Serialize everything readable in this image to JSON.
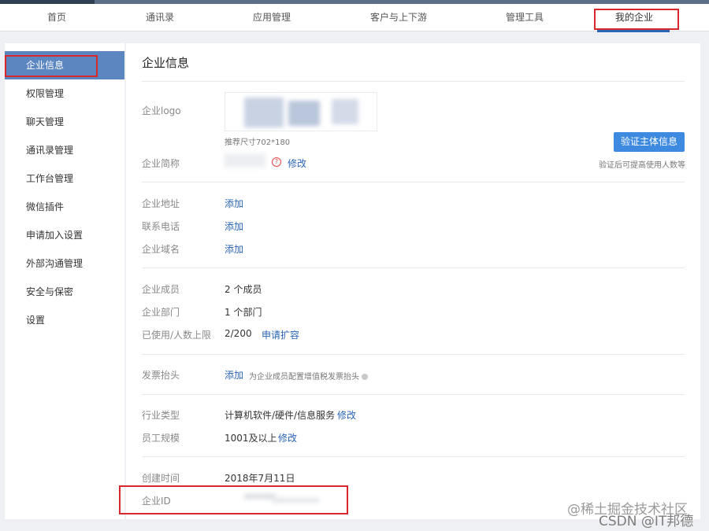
{
  "topnav": {
    "items": [
      "首页",
      "通讯录",
      "应用管理",
      "客户与上下游",
      "管理工具",
      "我的企业"
    ],
    "active": "我的企业"
  },
  "sidebar": {
    "items": [
      "企业信息",
      "权限管理",
      "聊天管理",
      "通讯录管理",
      "工作台管理",
      "微信插件",
      "申请加入设置",
      "外部沟通管理",
      "安全与保密",
      "设置"
    ]
  },
  "main": {
    "title": "企业信息",
    "logo": {
      "label": "企业logo",
      "hint": "推荐尺寸702*180"
    },
    "verify": {
      "button": "验证主体信息",
      "note": "验证后可提高使用人数等"
    },
    "short_name": {
      "label": "企业简称",
      "action": "修改"
    },
    "address": {
      "label": "企业地址",
      "action": "添加"
    },
    "phone": {
      "label": "联系电话",
      "action": "添加"
    },
    "domain": {
      "label": "企业域名",
      "action": "添加"
    },
    "members": {
      "label": "企业成员",
      "value": "2 个成员"
    },
    "departments": {
      "label": "企业部门",
      "value": "1 个部门"
    },
    "usage": {
      "label": "已使用/人数上限",
      "value": "2/200",
      "action": "申请扩容"
    },
    "invoice": {
      "label": "发票抬头",
      "action": "添加",
      "note": "为企业成员配置增值税发票抬头"
    },
    "industry": {
      "label": "行业类型",
      "value": "计算机软件/硬件/信息服务",
      "action": "修改"
    },
    "staff_size": {
      "label": "员工规模",
      "value": "1001及以上",
      "action": "修改"
    },
    "created": {
      "label": "创建时间",
      "value": "2018年7月11日"
    },
    "corp_id": {
      "label": "企业ID"
    }
  },
  "watermark": {
    "line1": "@稀土掘金技术社区",
    "line2": "CSDN @IT邦德"
  },
  "colors": {
    "accent": "#2a64b6",
    "sidebar_active": "#5b86c0",
    "button": "#3d8ae0",
    "highlight_box": "#d8282c"
  }
}
